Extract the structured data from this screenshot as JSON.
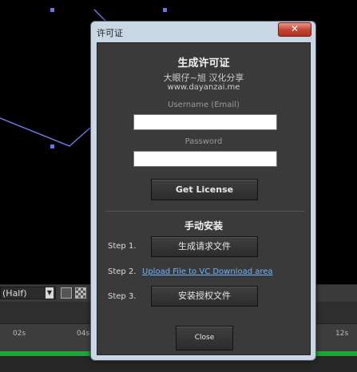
{
  "background": {
    "resolution_select": "(Half)",
    "timeline_ticks": [
      "02s",
      "04s",
      "12s"
    ]
  },
  "dialog": {
    "title": "许可证",
    "close_glyph": "✕",
    "heading": "生成许可证",
    "credit": "大眼仔~旭 汉化分享",
    "website": "www.dayanzai.me",
    "username_label": "Username (Email)",
    "username_value": "",
    "password_label": "Password",
    "password_value": "",
    "get_license_button": "Get License",
    "manual_heading": "手动安装",
    "steps": [
      {
        "label": "Step 1.",
        "action": "生成请求文件"
      },
      {
        "label": "Step 2.",
        "action": "Upload File to VC Download area"
      },
      {
        "label": "Step 3.",
        "action": "安装授权文件"
      }
    ],
    "close_button": "Close"
  }
}
